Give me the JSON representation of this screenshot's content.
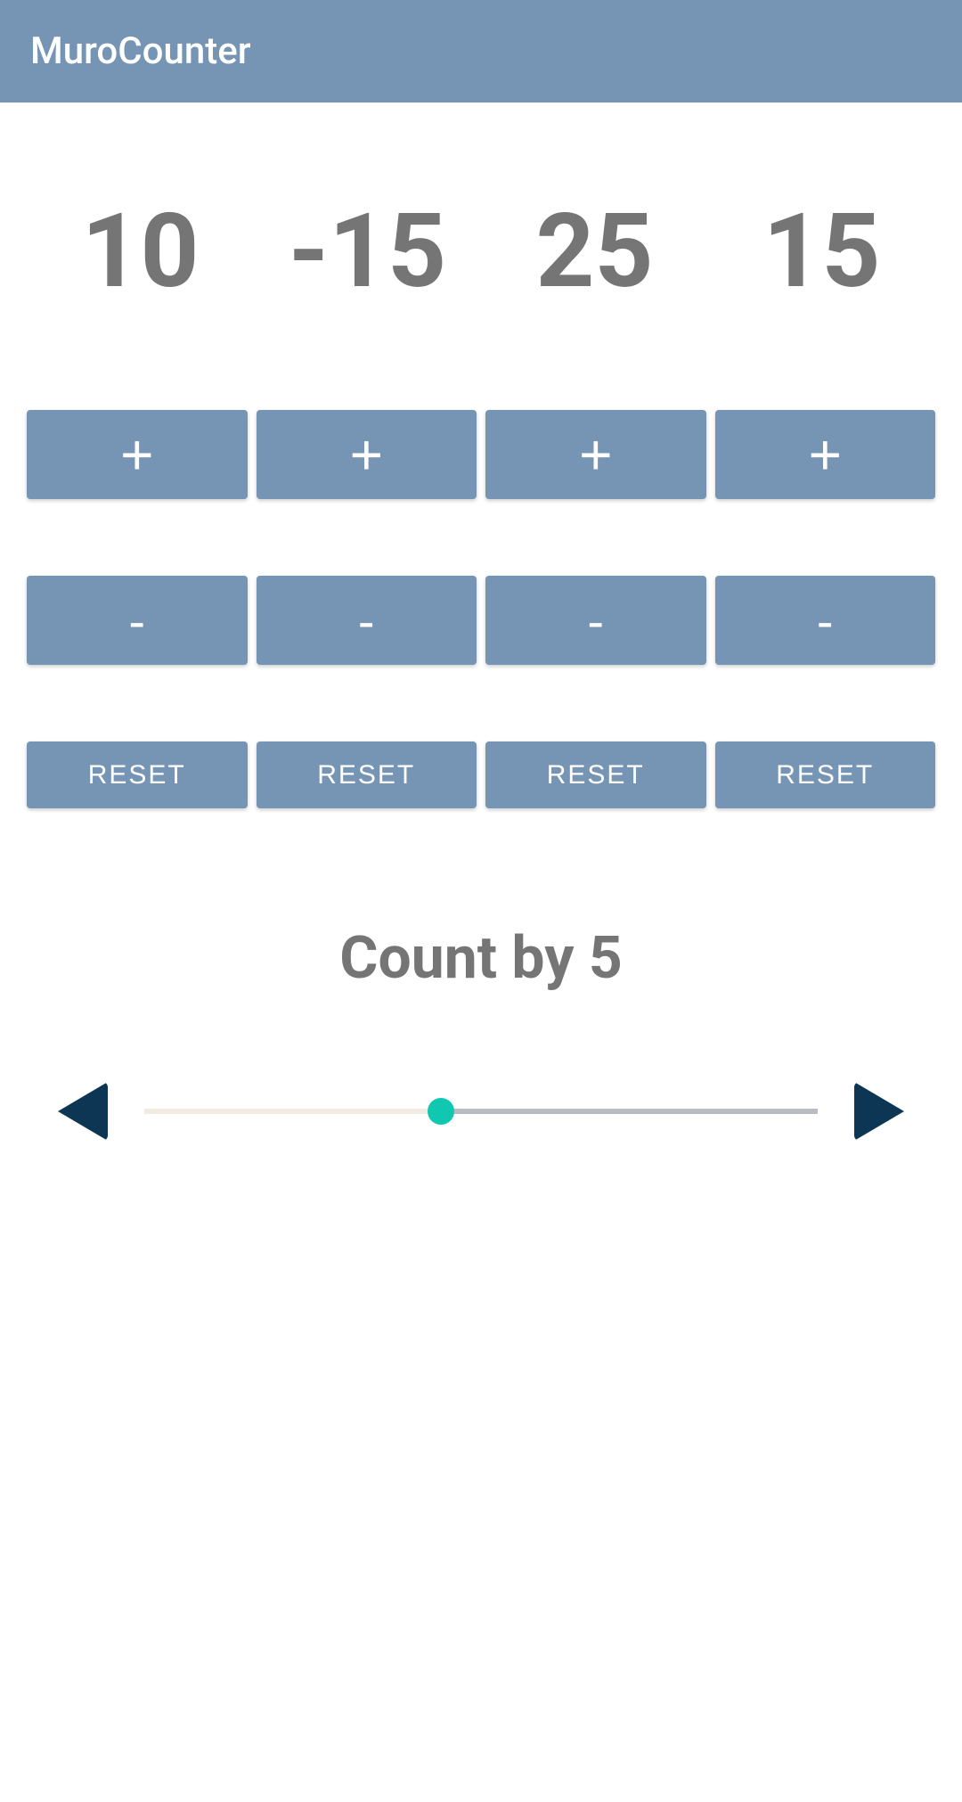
{
  "header": {
    "title": "MuroCounter"
  },
  "counters": [
    {
      "value": "10"
    },
    {
      "value": "-15"
    },
    {
      "value": "25"
    },
    {
      "value": "15"
    }
  ],
  "buttons": {
    "plus": "+",
    "minus": "-",
    "reset": "RESET"
  },
  "countBy": {
    "label": "Count by 5",
    "value": 5
  },
  "colors": {
    "primary": "#7694b4",
    "text": "#757575",
    "accent": "#10c8b0",
    "dark": "#0d3554"
  }
}
